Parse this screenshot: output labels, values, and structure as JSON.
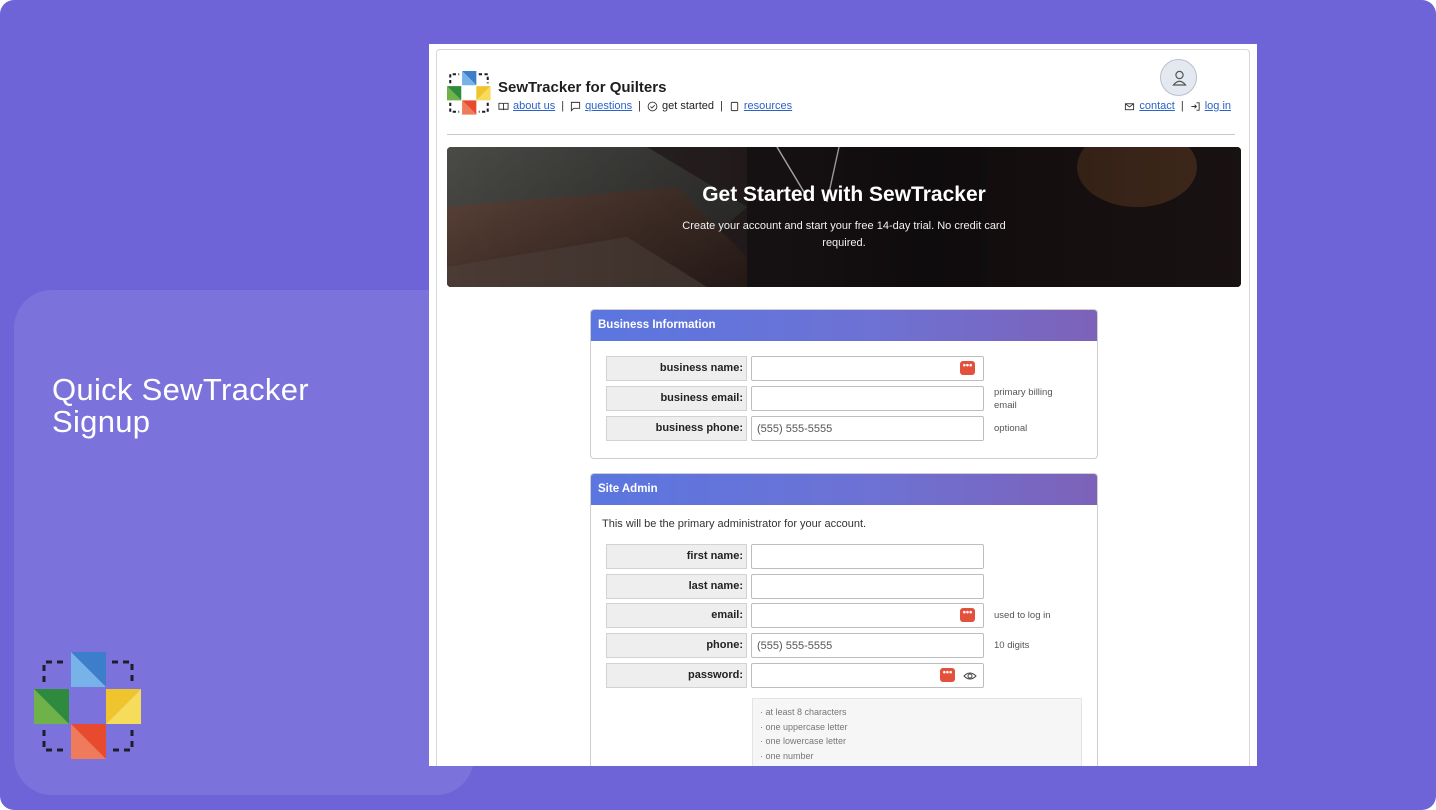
{
  "slide": {
    "title": "Quick SewTracker Signup"
  },
  "site": {
    "title": "SewTracker for Quilters",
    "nav": [
      {
        "label": "about us",
        "icon": "book-icon",
        "link": true
      },
      {
        "label": "questions",
        "icon": "chat-icon",
        "link": true
      },
      {
        "label": "get started",
        "icon": "check-circle-icon",
        "link": false
      },
      {
        "label": "resources",
        "icon": "document-icon",
        "link": true
      }
    ],
    "right_nav": [
      {
        "label": "contact",
        "icon": "mail-icon"
      },
      {
        "label": "log in",
        "icon": "login-icon"
      }
    ]
  },
  "hero": {
    "title": "Get Started with SewTracker",
    "subtitle": "Create your account and start your free 14-day trial. No credit card required."
  },
  "business": {
    "heading": "Business Information",
    "name_label": "business name:",
    "email_label": "business email:",
    "email_hint": "primary billing email",
    "phone_label": "business phone:",
    "phone_placeholder": "(555) 555-5555",
    "phone_hint": "optional"
  },
  "admin": {
    "heading": "Site Admin",
    "intro": "This will be the primary administrator for your account.",
    "first_label": "first name:",
    "last_label": "last name:",
    "email_label": "email:",
    "email_hint": "used to log in",
    "phone_label": "phone:",
    "phone_placeholder": "(555) 555-5555",
    "phone_hint": "10 digits",
    "password_label": "password:",
    "rules": [
      "· at least 8 characters",
      "· one uppercase letter",
      "· one lowercase letter",
      "· one number"
    ]
  },
  "colors": {
    "background": "#6f63d8",
    "panel": "#7c72dc",
    "link": "#2b63c9",
    "card_header_start": "#5b76e0",
    "card_header_end": "#7d62b9",
    "password_manager": "#e3513d"
  }
}
